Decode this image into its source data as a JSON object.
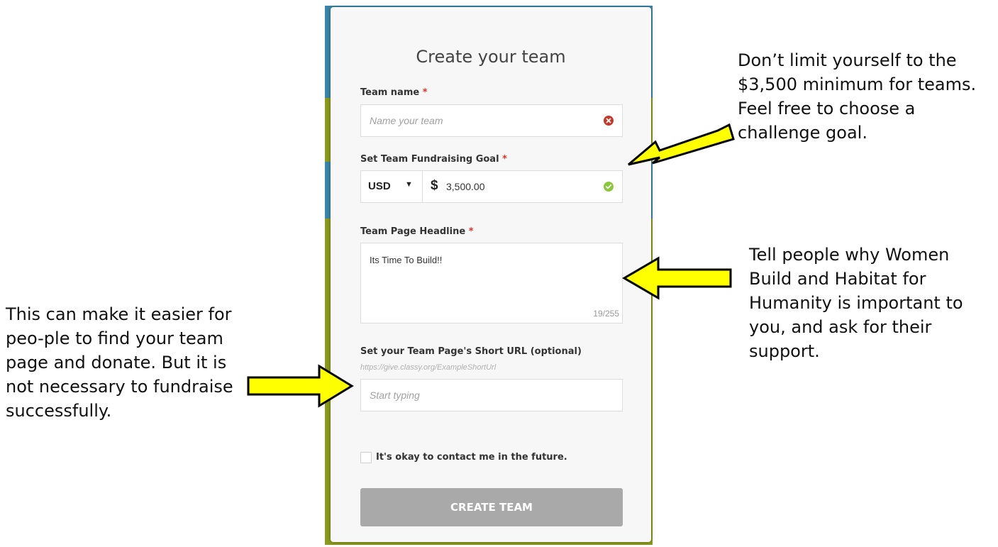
{
  "form": {
    "title": "Create your team",
    "required_mark": "*",
    "team_name": {
      "label": "Team name",
      "placeholder": "Name your team",
      "status": "error"
    },
    "goal": {
      "label": "Set Team Fundraising Goal",
      "currency": "USD",
      "currency_symbol": "$",
      "amount": "3,500.00",
      "status": "valid"
    },
    "headline": {
      "label": "Team Page Headline",
      "value": "Its Time To Build!!",
      "counter": "19/255"
    },
    "short_url": {
      "label": "Set your Team Page's Short URL (optional)",
      "hint": "https://give.classy.org/ExampleShortUrl",
      "placeholder": "Start typing"
    },
    "contact_opt_in": {
      "label": "It's okay to contact me in the future.",
      "checked": false
    },
    "submit_label": "CREATE TEAM"
  },
  "annotations": {
    "goal_note": "Don’t limit yourself to the $3,500 minimum for teams. Feel free to choose a challenge goal.",
    "headline_note": "Tell people why Women Build and Habitat for Humanity is important to you, and ask for their support.",
    "url_note": "This can make it easier for peo-ple to find your team page and donate. But it is not necessary to fundraise successfully."
  },
  "colors": {
    "arrow_fill": "#ffff00",
    "required": "#d9342b",
    "error_icon": "#c0392b",
    "valid_icon": "#8cc63f",
    "button": "#a9a9a9"
  },
  "icons": {
    "team_name_status": "error-circle-icon",
    "goal_status": "check-circle-icon",
    "currency_caret": "caret-down-icon"
  }
}
